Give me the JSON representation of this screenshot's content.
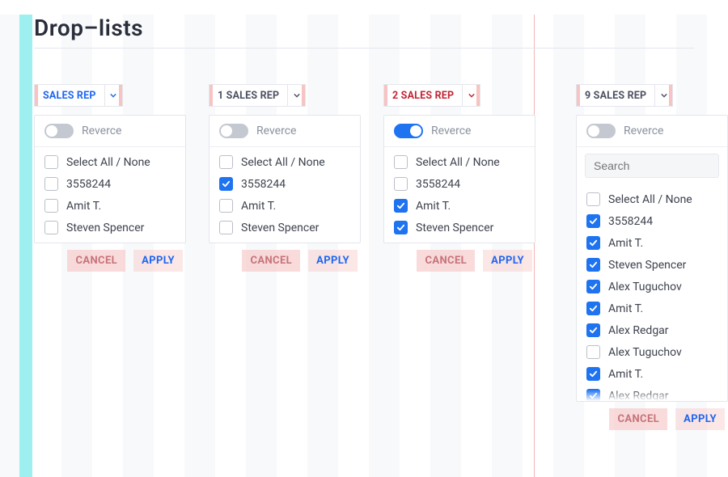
{
  "title": "Drop–lists",
  "common": {
    "reverse_label": "Reverce",
    "select_all_label": "Select All / None",
    "cancel_label": "CANCEL",
    "apply_label": "APPLY",
    "search_placeholder": "Search"
  },
  "panels": [
    {
      "trigger": {
        "text": "SALES REP",
        "style": "blue"
      },
      "reverse_on": false,
      "has_search": false,
      "options": [
        {
          "label": "3558244",
          "checked": false
        },
        {
          "label": "Amit T.",
          "checked": false
        },
        {
          "label": "Steven Spencer",
          "checked": false
        }
      ]
    },
    {
      "trigger": {
        "text": "1 SALES REP",
        "style": "gray"
      },
      "reverse_on": false,
      "has_search": false,
      "options": [
        {
          "label": "3558244",
          "checked": true
        },
        {
          "label": "Amit T.",
          "checked": false
        },
        {
          "label": "Steven Spencer",
          "checked": false
        }
      ]
    },
    {
      "trigger": {
        "text": "2 SALES REP",
        "style": "red"
      },
      "reverse_on": true,
      "has_search": false,
      "options": [
        {
          "label": "3558244",
          "checked": false
        },
        {
          "label": "Amit T.",
          "checked": true
        },
        {
          "label": "Steven Spencer",
          "checked": true
        }
      ]
    },
    {
      "trigger": {
        "text": "9 SALES REP",
        "style": "gray"
      },
      "reverse_on": false,
      "has_search": true,
      "options": [
        {
          "label": "3558244",
          "checked": true
        },
        {
          "label": "Amit T.",
          "checked": true
        },
        {
          "label": "Steven Spencer",
          "checked": true
        },
        {
          "label": "Alex Tuguchov",
          "checked": true
        },
        {
          "label": "Amit T.",
          "checked": true
        },
        {
          "label": "Alex Redgar",
          "checked": true
        },
        {
          "label": "Alex Tuguchov",
          "checked": false
        },
        {
          "label": "Amit T.",
          "checked": true
        },
        {
          "label": "Alex Redgar",
          "checked": true
        }
      ]
    }
  ]
}
